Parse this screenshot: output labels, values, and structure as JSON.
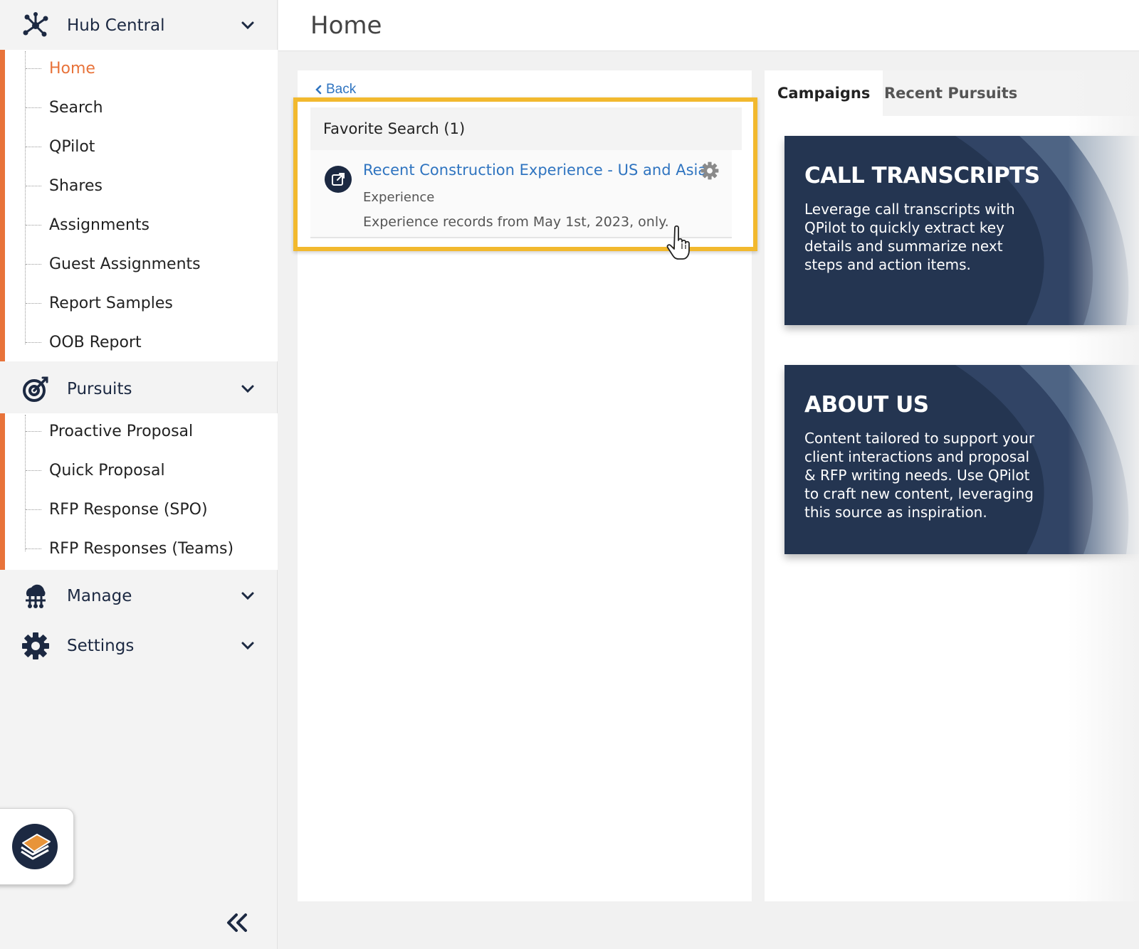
{
  "sidebar": {
    "sections": [
      {
        "label": "Hub Central",
        "icon": "hub-network-icon"
      },
      {
        "label": "Pursuits",
        "icon": "target-icon"
      },
      {
        "label": "Manage",
        "icon": "cloud-network-icon"
      },
      {
        "label": "Settings",
        "icon": "gear-icon"
      }
    ],
    "hub_items": [
      "Home",
      "Search",
      "QPilot",
      "Shares",
      "Assignments",
      "Guest Assignments",
      "Report Samples",
      "OOB Report"
    ],
    "pursuit_items": [
      "Proactive Proposal",
      "Quick Proposal",
      "RFP Response (SPO)",
      "RFP Responses (Teams)"
    ],
    "active_item": "Home",
    "launcher_icon": "layers-app-icon",
    "collapse_icon": "double-chevron-left-icon"
  },
  "header": {
    "title": "Home"
  },
  "center": {
    "back_label": "Back",
    "favorites": {
      "heading": "Favorite Search (1)",
      "items": [
        {
          "title": "Recent Construction Experience - US and Asia",
          "type": "Experience",
          "description": "Experience records from May 1st, 2023, only."
        }
      ]
    }
  },
  "right": {
    "tabs": [
      "Campaigns",
      "Recent Pursuits"
    ],
    "active_tab": "Campaigns",
    "cards": [
      {
        "title": "CALL TRANSCRIPTS",
        "body": "Leverage call transcripts with QPilot to quickly extract key details and summarize next steps and action items."
      },
      {
        "title": "ABOUT US",
        "body": "Content tailored to support your client interactions and proposal & RFP writing needs. Use QPilot to craft new content, leveraging this source as inspiration."
      }
    ]
  },
  "colors": {
    "accent": "#e8733a",
    "link": "#2f74c0",
    "navy": "#1c2942",
    "highlight": "#f2b92e"
  }
}
